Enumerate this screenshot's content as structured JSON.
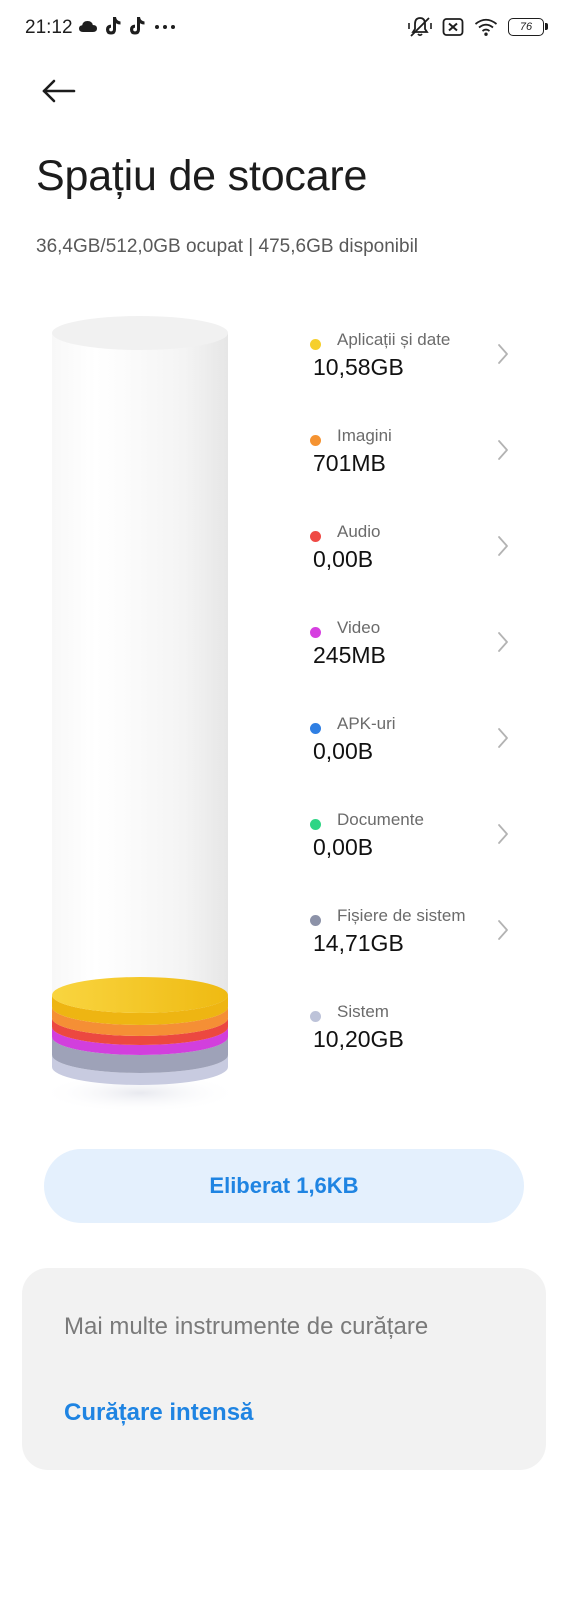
{
  "status_bar": {
    "time": "21:12",
    "left_icons": [
      "cloud-icon",
      "tiktok-icon",
      "tiktok-icon",
      "more-icon"
    ],
    "right_icons": [
      "vibrate-off-icon",
      "no-sim-icon",
      "wifi-icon"
    ],
    "battery": "76"
  },
  "header": {
    "back_icon": "arrow-left-icon",
    "title": "Spațiu de stocare",
    "summary": "36,4GB/512,0GB ocupat | 475,6GB disponibil"
  },
  "categories": [
    {
      "label": "Aplicații și date",
      "size": "10,58GB",
      "color": "#f6cf2c",
      "has_chevron": true
    },
    {
      "label": "Imagini",
      "size": "701MB",
      "color": "#f59331",
      "has_chevron": true
    },
    {
      "label": "Audio",
      "size": "0,00B",
      "color": "#ef4a45",
      "has_chevron": true
    },
    {
      "label": "Video",
      "size": "245MB",
      "color": "#d63fe0",
      "has_chevron": true
    },
    {
      "label": "APK-uri",
      "size": "0,00B",
      "color": "#2f7fe3",
      "has_chevron": true
    },
    {
      "label": "Documente",
      "size": "0,00B",
      "color": "#2fd585",
      "has_chevron": true
    },
    {
      "label": "Fișiere de sistem",
      "size": "14,71GB",
      "color": "#8c92a8",
      "has_chevron": true
    },
    {
      "label": "Sistem",
      "size": "10,20GB",
      "color": "#bdc3d9",
      "has_chevron": false
    }
  ],
  "free_button": {
    "label": "Eliberat 1,6KB"
  },
  "tools": {
    "title": "Mai multe instrumente de curățare",
    "link": "Curățare intensă"
  },
  "colors": {
    "accent": "#1f84e2",
    "button_bg": "#e4f0fd",
    "card_bg": "#f2f2f2"
  }
}
